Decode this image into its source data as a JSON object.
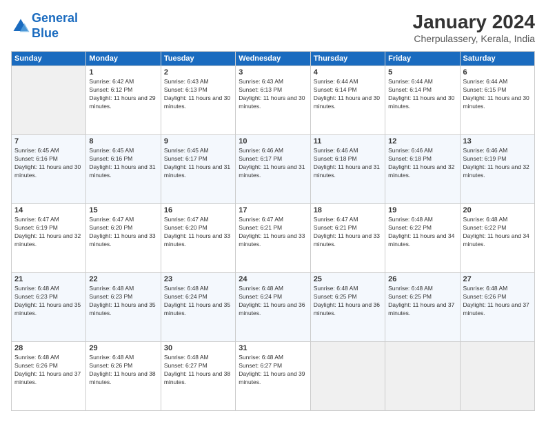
{
  "header": {
    "logo_line1": "General",
    "logo_line2": "Blue",
    "month_year": "January 2024",
    "location": "Cherpulassery, Kerala, India"
  },
  "weekdays": [
    "Sunday",
    "Monday",
    "Tuesday",
    "Wednesday",
    "Thursday",
    "Friday",
    "Saturday"
  ],
  "weeks": [
    [
      {
        "day": "",
        "sunrise": "",
        "sunset": "",
        "daylight": ""
      },
      {
        "day": "1",
        "sunrise": "Sunrise: 6:42 AM",
        "sunset": "Sunset: 6:12 PM",
        "daylight": "Daylight: 11 hours and 29 minutes."
      },
      {
        "day": "2",
        "sunrise": "Sunrise: 6:43 AM",
        "sunset": "Sunset: 6:13 PM",
        "daylight": "Daylight: 11 hours and 30 minutes."
      },
      {
        "day": "3",
        "sunrise": "Sunrise: 6:43 AM",
        "sunset": "Sunset: 6:13 PM",
        "daylight": "Daylight: 11 hours and 30 minutes."
      },
      {
        "day": "4",
        "sunrise": "Sunrise: 6:44 AM",
        "sunset": "Sunset: 6:14 PM",
        "daylight": "Daylight: 11 hours and 30 minutes."
      },
      {
        "day": "5",
        "sunrise": "Sunrise: 6:44 AM",
        "sunset": "Sunset: 6:14 PM",
        "daylight": "Daylight: 11 hours and 30 minutes."
      },
      {
        "day": "6",
        "sunrise": "Sunrise: 6:44 AM",
        "sunset": "Sunset: 6:15 PM",
        "daylight": "Daylight: 11 hours and 30 minutes."
      }
    ],
    [
      {
        "day": "7",
        "sunrise": "Sunrise: 6:45 AM",
        "sunset": "Sunset: 6:16 PM",
        "daylight": "Daylight: 11 hours and 30 minutes."
      },
      {
        "day": "8",
        "sunrise": "Sunrise: 6:45 AM",
        "sunset": "Sunset: 6:16 PM",
        "daylight": "Daylight: 11 hours and 31 minutes."
      },
      {
        "day": "9",
        "sunrise": "Sunrise: 6:45 AM",
        "sunset": "Sunset: 6:17 PM",
        "daylight": "Daylight: 11 hours and 31 minutes."
      },
      {
        "day": "10",
        "sunrise": "Sunrise: 6:46 AM",
        "sunset": "Sunset: 6:17 PM",
        "daylight": "Daylight: 11 hours and 31 minutes."
      },
      {
        "day": "11",
        "sunrise": "Sunrise: 6:46 AM",
        "sunset": "Sunset: 6:18 PM",
        "daylight": "Daylight: 11 hours and 31 minutes."
      },
      {
        "day": "12",
        "sunrise": "Sunrise: 6:46 AM",
        "sunset": "Sunset: 6:18 PM",
        "daylight": "Daylight: 11 hours and 32 minutes."
      },
      {
        "day": "13",
        "sunrise": "Sunrise: 6:46 AM",
        "sunset": "Sunset: 6:19 PM",
        "daylight": "Daylight: 11 hours and 32 minutes."
      }
    ],
    [
      {
        "day": "14",
        "sunrise": "Sunrise: 6:47 AM",
        "sunset": "Sunset: 6:19 PM",
        "daylight": "Daylight: 11 hours and 32 minutes."
      },
      {
        "day": "15",
        "sunrise": "Sunrise: 6:47 AM",
        "sunset": "Sunset: 6:20 PM",
        "daylight": "Daylight: 11 hours and 33 minutes."
      },
      {
        "day": "16",
        "sunrise": "Sunrise: 6:47 AM",
        "sunset": "Sunset: 6:20 PM",
        "daylight": "Daylight: 11 hours and 33 minutes."
      },
      {
        "day": "17",
        "sunrise": "Sunrise: 6:47 AM",
        "sunset": "Sunset: 6:21 PM",
        "daylight": "Daylight: 11 hours and 33 minutes."
      },
      {
        "day": "18",
        "sunrise": "Sunrise: 6:47 AM",
        "sunset": "Sunset: 6:21 PM",
        "daylight": "Daylight: 11 hours and 33 minutes."
      },
      {
        "day": "19",
        "sunrise": "Sunrise: 6:48 AM",
        "sunset": "Sunset: 6:22 PM",
        "daylight": "Daylight: 11 hours and 34 minutes."
      },
      {
        "day": "20",
        "sunrise": "Sunrise: 6:48 AM",
        "sunset": "Sunset: 6:22 PM",
        "daylight": "Daylight: 11 hours and 34 minutes."
      }
    ],
    [
      {
        "day": "21",
        "sunrise": "Sunrise: 6:48 AM",
        "sunset": "Sunset: 6:23 PM",
        "daylight": "Daylight: 11 hours and 35 minutes."
      },
      {
        "day": "22",
        "sunrise": "Sunrise: 6:48 AM",
        "sunset": "Sunset: 6:23 PM",
        "daylight": "Daylight: 11 hours and 35 minutes."
      },
      {
        "day": "23",
        "sunrise": "Sunrise: 6:48 AM",
        "sunset": "Sunset: 6:24 PM",
        "daylight": "Daylight: 11 hours and 35 minutes."
      },
      {
        "day": "24",
        "sunrise": "Sunrise: 6:48 AM",
        "sunset": "Sunset: 6:24 PM",
        "daylight": "Daylight: 11 hours and 36 minutes."
      },
      {
        "day": "25",
        "sunrise": "Sunrise: 6:48 AM",
        "sunset": "Sunset: 6:25 PM",
        "daylight": "Daylight: 11 hours and 36 minutes."
      },
      {
        "day": "26",
        "sunrise": "Sunrise: 6:48 AM",
        "sunset": "Sunset: 6:25 PM",
        "daylight": "Daylight: 11 hours and 37 minutes."
      },
      {
        "day": "27",
        "sunrise": "Sunrise: 6:48 AM",
        "sunset": "Sunset: 6:26 PM",
        "daylight": "Daylight: 11 hours and 37 minutes."
      }
    ],
    [
      {
        "day": "28",
        "sunrise": "Sunrise: 6:48 AM",
        "sunset": "Sunset: 6:26 PM",
        "daylight": "Daylight: 11 hours and 37 minutes."
      },
      {
        "day": "29",
        "sunrise": "Sunrise: 6:48 AM",
        "sunset": "Sunset: 6:26 PM",
        "daylight": "Daylight: 11 hours and 38 minutes."
      },
      {
        "day": "30",
        "sunrise": "Sunrise: 6:48 AM",
        "sunset": "Sunset: 6:27 PM",
        "daylight": "Daylight: 11 hours and 38 minutes."
      },
      {
        "day": "31",
        "sunrise": "Sunrise: 6:48 AM",
        "sunset": "Sunset: 6:27 PM",
        "daylight": "Daylight: 11 hours and 39 minutes."
      },
      {
        "day": "",
        "sunrise": "",
        "sunset": "",
        "daylight": ""
      },
      {
        "day": "",
        "sunrise": "",
        "sunset": "",
        "daylight": ""
      },
      {
        "day": "",
        "sunrise": "",
        "sunset": "",
        "daylight": ""
      }
    ]
  ]
}
